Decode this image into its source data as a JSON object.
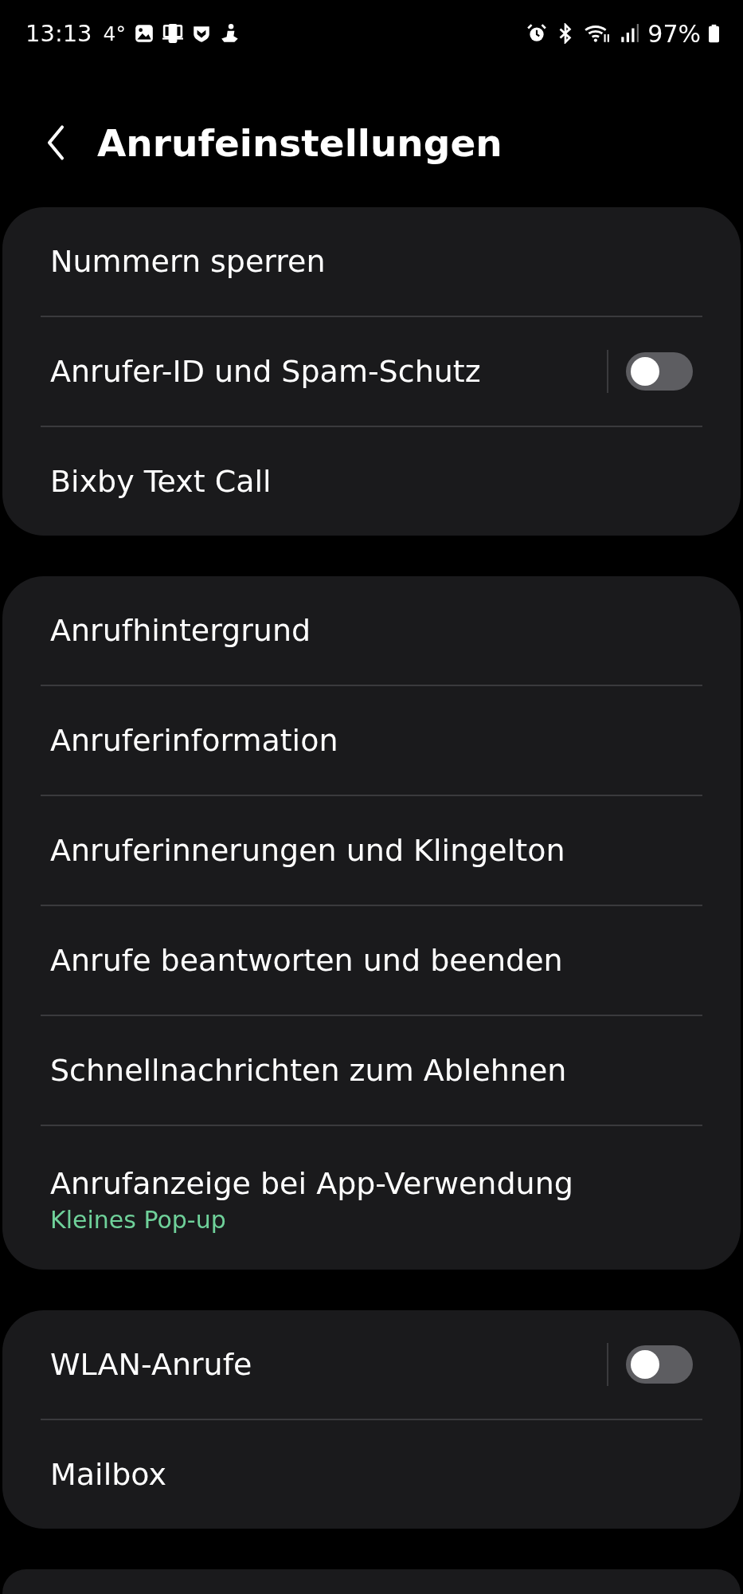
{
  "status_bar": {
    "time": "13:13",
    "temperature": "4°",
    "battery": "97%"
  },
  "header": {
    "title": "Anrufeinstellungen"
  },
  "groups": [
    {
      "items": [
        {
          "label": "Nummern sperren",
          "kind": "link"
        },
        {
          "label": "Anrufer-ID und Spam-Schutz",
          "kind": "toggle",
          "on": false
        },
        {
          "label": "Bixby Text Call",
          "kind": "link"
        }
      ]
    },
    {
      "items": [
        {
          "label": "Anrufhintergrund",
          "kind": "link"
        },
        {
          "label": "Anruferinformation",
          "kind": "link"
        },
        {
          "label": "Anruferinnerungen und Klingelton",
          "kind": "link"
        },
        {
          "label": "Anrufe beantworten und beenden",
          "kind": "link"
        },
        {
          "label": "Schnellnachrichten zum Ablehnen",
          "kind": "link"
        },
        {
          "label": "Anrufanzeige bei App-Verwendung",
          "kind": "link",
          "subtitle": "Kleines Pop-up"
        }
      ]
    },
    {
      "items": [
        {
          "label": "WLAN-Anrufe",
          "kind": "toggle",
          "on": false
        },
        {
          "label": "Mailbox",
          "kind": "link"
        }
      ]
    },
    {
      "cut_off": true
    }
  ]
}
